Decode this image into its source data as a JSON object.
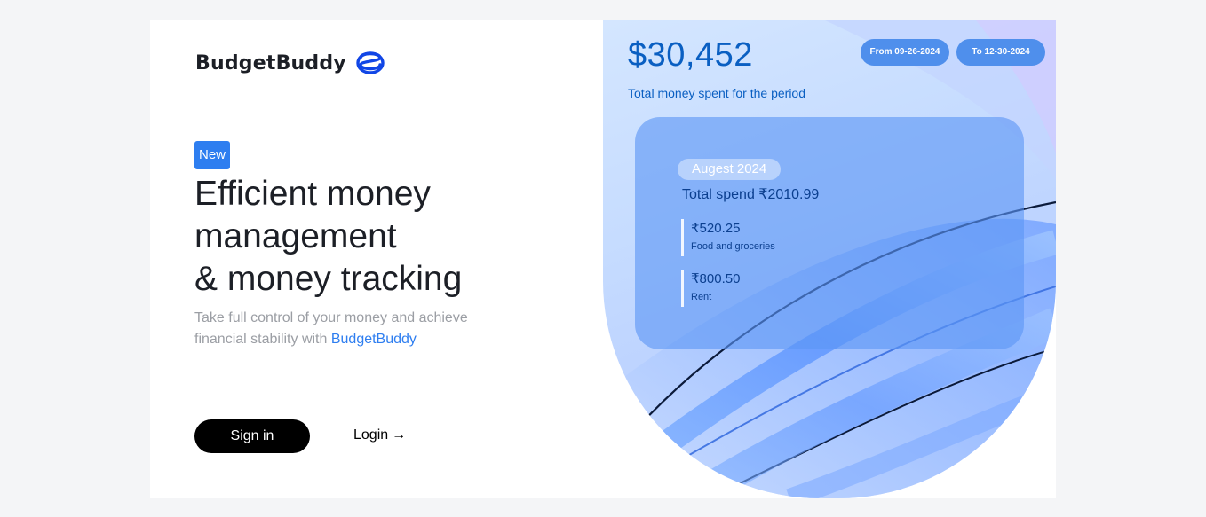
{
  "brand": {
    "name": "BudgetBuddy",
    "logo_icon": "budgetbuddy-logo-icon",
    "color": "#1146e6"
  },
  "hero_left": {
    "badge": "New",
    "headline": [
      "Efficient money",
      "management",
      "& money tracking"
    ],
    "subtext_prefix": "Take full control of your money and achieve financial stability with ",
    "subtext_brand": "BudgetBuddy",
    "signin_label": "Sign in",
    "login_label": "Login",
    "login_arrow": "→"
  },
  "stats": {
    "total_amount": "$30,452",
    "total_caption": "Total money spent for the period",
    "date_from": "From 09-26-2024",
    "date_to": "To 12-30-2024"
  },
  "summary": {
    "month": "Augest 2024",
    "total_spend": "Total spend ₹2010.99",
    "expenses": [
      {
        "amount": "₹520.25",
        "label": "Food and groceries"
      },
      {
        "amount": "₹800.50",
        "label": "Rent"
      }
    ]
  },
  "colors": {
    "accent": "#2e7ef0",
    "text_dark": "#1c1f26",
    "muted": "#9b9ea4",
    "stat_blue": "#0a5fc2"
  }
}
